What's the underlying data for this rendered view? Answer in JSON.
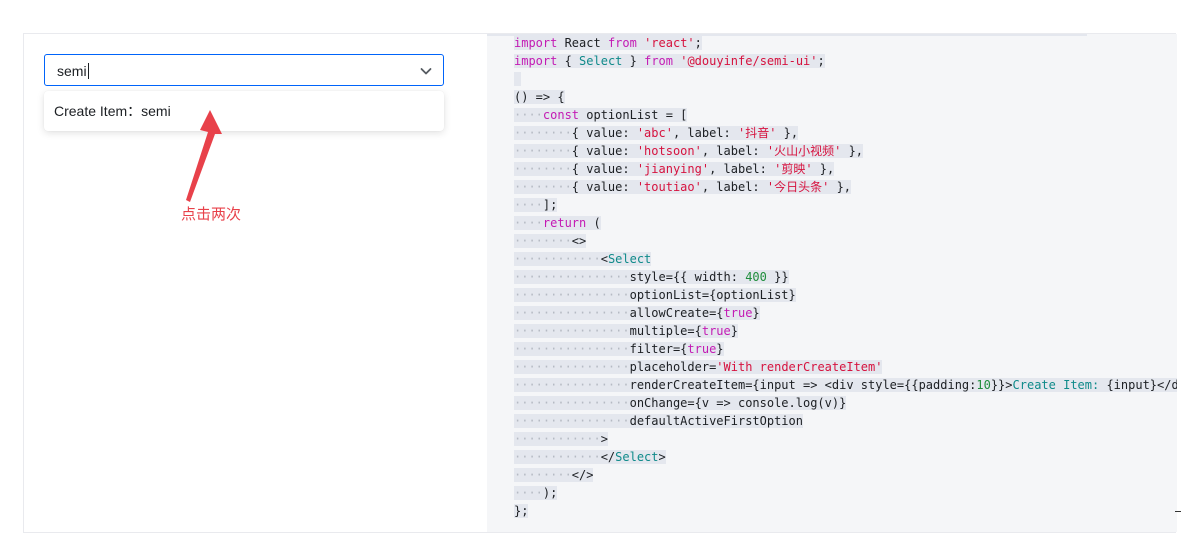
{
  "demo": {
    "select_value": "semi",
    "create_option_label": "Create Item：semi",
    "annotation": "点击两次",
    "accent_color": "#0064fa",
    "annotation_color": "#e8414a"
  },
  "code": {
    "lines": [
      [
        [
          "kw",
          "import"
        ],
        [
          "plain",
          " React "
        ],
        [
          "kw",
          "from"
        ],
        [
          "plain",
          " "
        ],
        [
          "str",
          "'react'"
        ],
        [
          "plain",
          ";"
        ]
      ],
      [
        [
          "kw",
          "import"
        ],
        [
          "plain",
          " { "
        ],
        [
          "tag",
          "Select"
        ],
        [
          "plain",
          " } "
        ],
        [
          "kw",
          "from"
        ],
        [
          "plain",
          " "
        ],
        [
          "str",
          "'@douyinfe/semi-ui'"
        ],
        [
          "plain",
          ";"
        ]
      ],
      [
        [
          "plain",
          " "
        ]
      ],
      [
        [
          "plain",
          "() => {"
        ]
      ],
      [
        [
          "ind",
          "    "
        ],
        [
          "kw",
          "const"
        ],
        [
          "plain",
          " optionList = ["
        ]
      ],
      [
        [
          "ind",
          "        "
        ],
        [
          "plain",
          "{ value: "
        ],
        [
          "str",
          "'abc'"
        ],
        [
          "plain",
          ", label: "
        ],
        [
          "str",
          "'抖音'"
        ],
        [
          "plain",
          " },"
        ]
      ],
      [
        [
          "ind",
          "        "
        ],
        [
          "plain",
          "{ value: "
        ],
        [
          "str",
          "'hotsoon'"
        ],
        [
          "plain",
          ", label: "
        ],
        [
          "str",
          "'火山小视频'"
        ],
        [
          "plain",
          " },"
        ]
      ],
      [
        [
          "ind",
          "        "
        ],
        [
          "plain",
          "{ value: "
        ],
        [
          "str",
          "'jianying'"
        ],
        [
          "plain",
          ", label: "
        ],
        [
          "str",
          "'剪映'"
        ],
        [
          "plain",
          " },"
        ]
      ],
      [
        [
          "ind",
          "        "
        ],
        [
          "plain",
          "{ value: "
        ],
        [
          "str",
          "'toutiao'"
        ],
        [
          "plain",
          ", label: "
        ],
        [
          "str",
          "'今日头条'"
        ],
        [
          "plain",
          " },"
        ]
      ],
      [
        [
          "ind",
          "    "
        ],
        [
          "plain",
          "];"
        ]
      ],
      [
        [
          "ind",
          "    "
        ],
        [
          "kw",
          "return"
        ],
        [
          "plain",
          " ("
        ]
      ],
      [
        [
          "ind",
          "        "
        ],
        [
          "plain",
          "<>"
        ]
      ],
      [
        [
          "ind",
          "            "
        ],
        [
          "plain",
          "<"
        ],
        [
          "tag",
          "Select"
        ]
      ],
      [
        [
          "ind",
          "                "
        ],
        [
          "plain",
          "style={{ width: "
        ],
        [
          "num",
          "400"
        ],
        [
          "plain",
          " }}"
        ]
      ],
      [
        [
          "ind",
          "                "
        ],
        [
          "plain",
          "optionList={optionList}"
        ]
      ],
      [
        [
          "ind",
          "                "
        ],
        [
          "plain",
          "allowCreate={"
        ],
        [
          "kw",
          "true"
        ],
        [
          "plain",
          "}"
        ]
      ],
      [
        [
          "ind",
          "                "
        ],
        [
          "plain",
          "multiple={"
        ],
        [
          "kw",
          "true"
        ],
        [
          "plain",
          "}"
        ]
      ],
      [
        [
          "ind",
          "                "
        ],
        [
          "plain",
          "filter={"
        ],
        [
          "kw",
          "true"
        ],
        [
          "plain",
          "}"
        ]
      ],
      [
        [
          "ind",
          "                "
        ],
        [
          "plain",
          "placeholder="
        ],
        [
          "str",
          "'With renderCreateItem'"
        ]
      ],
      [
        [
          "ind",
          "                "
        ],
        [
          "plain",
          "renderCreateItem={input => <div style={{padding:"
        ],
        [
          "num",
          "10"
        ],
        [
          "plain",
          "}}>"
        ],
        [
          "tag",
          "Create Item:"
        ],
        [
          "plain",
          " {input}</div>}"
        ]
      ],
      [
        [
          "ind",
          "                "
        ],
        [
          "plain",
          "onChange={v => console.log(v)}"
        ]
      ],
      [
        [
          "ind",
          "                "
        ],
        [
          "plain",
          "defaultActiveFirstOption"
        ]
      ],
      [
        [
          "ind",
          "            "
        ],
        [
          "plain",
          ">"
        ]
      ],
      [
        [
          "ind",
          "            "
        ],
        [
          "plain",
          "</"
        ],
        [
          "tag",
          "Select"
        ],
        [
          "plain",
          ">"
        ]
      ],
      [
        [
          "ind",
          "        "
        ],
        [
          "plain",
          "</>"
        ]
      ],
      [
        [
          "ind",
          "    "
        ],
        [
          "plain",
          ");"
        ]
      ],
      [
        [
          "plain",
          "};"
        ]
      ]
    ]
  }
}
